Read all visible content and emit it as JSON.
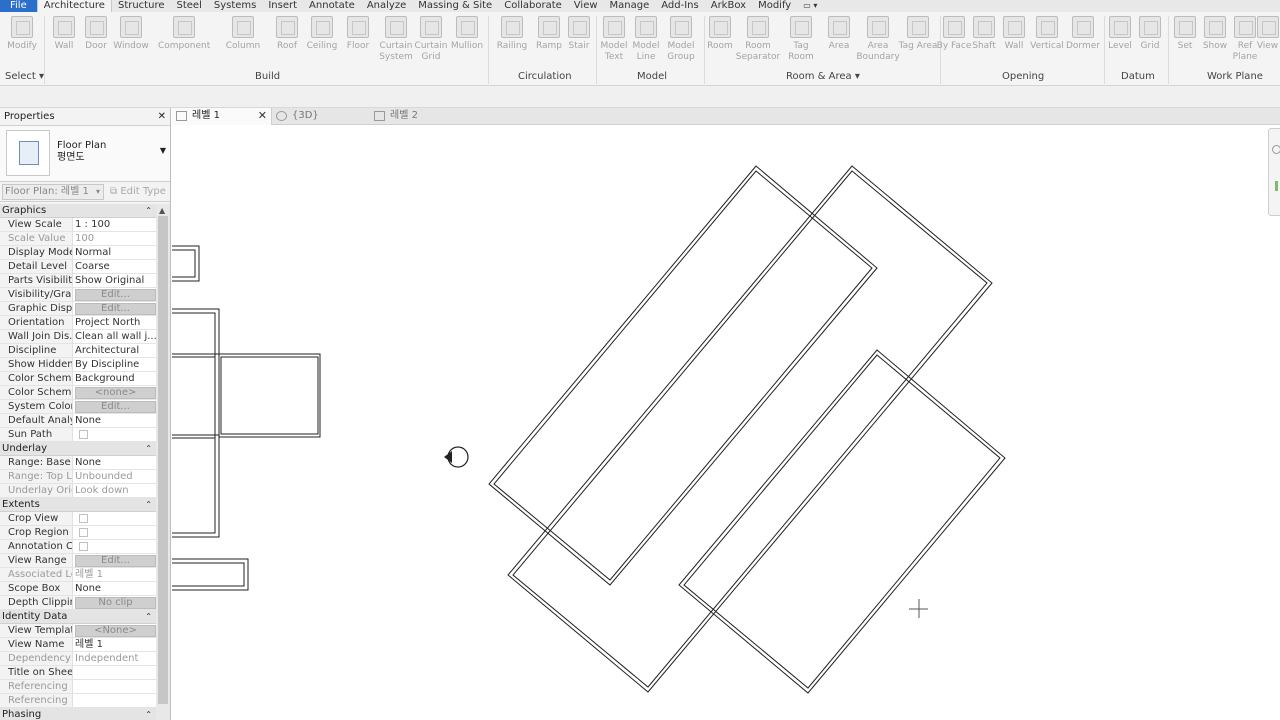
{
  "menu": {
    "items": [
      "File",
      "Architecture",
      "Structure",
      "Steel",
      "Systems",
      "Insert",
      "Annotate",
      "Analyze",
      "Massing & Site",
      "Collaborate",
      "View",
      "Manage",
      "Add-Ins",
      "ArkBox",
      "Modify"
    ],
    "extra": "▭ ▾"
  },
  "ribbon": {
    "tools": [
      {
        "id": "modify",
        "label": "Modify"
      },
      {
        "id": "wall",
        "label": "Wall"
      },
      {
        "id": "door",
        "label": "Door"
      },
      {
        "id": "window",
        "label": "Window"
      },
      {
        "id": "component",
        "label": "Component"
      },
      {
        "id": "column",
        "label": "Column"
      },
      {
        "id": "roof",
        "label": "Roof"
      },
      {
        "id": "ceiling",
        "label": "Ceiling"
      },
      {
        "id": "floor",
        "label": "Floor"
      },
      {
        "id": "curtain-system",
        "label": "Curtain System"
      },
      {
        "id": "curtain-grid",
        "label": "Curtain Grid"
      },
      {
        "id": "mullion",
        "label": "Mullion"
      },
      {
        "id": "railing",
        "label": "Railing"
      },
      {
        "id": "ramp",
        "label": "Ramp"
      },
      {
        "id": "stair",
        "label": "Stair"
      },
      {
        "id": "model-text",
        "label": "Model Text"
      },
      {
        "id": "model-line",
        "label": "Model Line"
      },
      {
        "id": "model-group",
        "label": "Model Group"
      },
      {
        "id": "room",
        "label": "Room"
      },
      {
        "id": "room-separator",
        "label": "Room Separator"
      },
      {
        "id": "tag-room",
        "label": "Tag Room"
      },
      {
        "id": "area",
        "label": "Area"
      },
      {
        "id": "area-boundary",
        "label": "Area Boundary"
      },
      {
        "id": "tag-area",
        "label": "Tag Area"
      },
      {
        "id": "by-face",
        "label": "By Face"
      },
      {
        "id": "shaft",
        "label": "Shaft"
      },
      {
        "id": "wall-opening",
        "label": "Wall"
      },
      {
        "id": "vertical",
        "label": "Vertical"
      },
      {
        "id": "dormer",
        "label": "Dormer"
      },
      {
        "id": "level",
        "label": "Level"
      },
      {
        "id": "grid",
        "label": "Grid"
      },
      {
        "id": "set",
        "label": "Set"
      },
      {
        "id": "show",
        "label": "Show"
      },
      {
        "id": "ref-plane",
        "label": "Ref Plane"
      },
      {
        "id": "viewer",
        "label": "View"
      }
    ],
    "panels": {
      "select": "Select ▾",
      "build": "Build",
      "circulation": "Circulation",
      "model": "Model",
      "room_area": "Room & Area ▾",
      "opening": "Opening",
      "datum": "Datum",
      "work_plane": "Work Plane"
    }
  },
  "properties": {
    "title": "Properties",
    "close": "✕",
    "type_name_1": "Floor Plan",
    "type_name_2": "평면도",
    "view_selector": "Floor Plan: 레벨 1",
    "edit_type": "Edit Type",
    "categories": [
      {
        "name": "Graphics",
        "rows": [
          {
            "n": "View Scale",
            "v": "1 : 100"
          },
          {
            "n": "Scale Value",
            "v": "100",
            "ro": true
          },
          {
            "n": "Display Model",
            "v": "Normal"
          },
          {
            "n": "Detail Level",
            "v": "Coarse"
          },
          {
            "n": "Parts Visibility",
            "v": "Show Original"
          },
          {
            "n": "Visibility/Gra...",
            "v": "Edit...",
            "btn": true
          },
          {
            "n": "Graphic Displ...",
            "v": "Edit...",
            "btn": true
          },
          {
            "n": "Orientation",
            "v": "Project North"
          },
          {
            "n": "Wall Join Dis...",
            "v": "Clean all wall j..."
          },
          {
            "n": "Discipline",
            "v": "Architectural"
          },
          {
            "n": "Show Hidden...",
            "v": "By Discipline"
          },
          {
            "n": "Color Schem...",
            "v": "Background"
          },
          {
            "n": "Color Scheme",
            "v": "<none>",
            "btn": true
          },
          {
            "n": "System Color...",
            "v": "Edit...",
            "btn": true
          },
          {
            "n": "Default Analy...",
            "v": "None"
          },
          {
            "n": "Sun Path",
            "v": "",
            "chk": true
          }
        ]
      },
      {
        "name": "Underlay",
        "rows": [
          {
            "n": "Range: Base ...",
            "v": "None"
          },
          {
            "n": "Range: Top L...",
            "v": "Unbounded",
            "ro": true
          },
          {
            "n": "Underlay Orie...",
            "v": "Look down",
            "ro": true
          }
        ]
      },
      {
        "name": "Extents",
        "rows": [
          {
            "n": "Crop View",
            "v": "",
            "chk": true
          },
          {
            "n": "Crop Region ...",
            "v": "",
            "chk": true
          },
          {
            "n": "Annotation C...",
            "v": "",
            "chk": true
          },
          {
            "n": "View Range",
            "v": "Edit...",
            "btn": true
          },
          {
            "n": "Associated Le...",
            "v": "레벨 1",
            "ro": true
          },
          {
            "n": "Scope Box",
            "v": "None"
          },
          {
            "n": "Depth Clipping",
            "v": "No clip",
            "btn": true
          }
        ]
      },
      {
        "name": "Identity Data",
        "rows": [
          {
            "n": "View Template",
            "v": "<None>",
            "btn": true
          },
          {
            "n": "View Name",
            "v": "레벨 1"
          },
          {
            "n": "Dependency",
            "v": "Independent",
            "ro": true
          },
          {
            "n": "Title on Sheet",
            "v": ""
          },
          {
            "n": "Referencing ...",
            "v": "",
            "ro": true
          },
          {
            "n": "Referencing ...",
            "v": "",
            "ro": true
          }
        ]
      },
      {
        "name": "Phasing",
        "rows": []
      }
    ]
  },
  "view_tabs": [
    {
      "label": "레벨 1",
      "active": true,
      "close": "✕"
    },
    {
      "label": "{3D}",
      "active": false
    },
    {
      "label": "레벨 2",
      "active": false
    }
  ],
  "colors": {
    "accent": "#2a6fc9",
    "wall_line": "#222222"
  }
}
